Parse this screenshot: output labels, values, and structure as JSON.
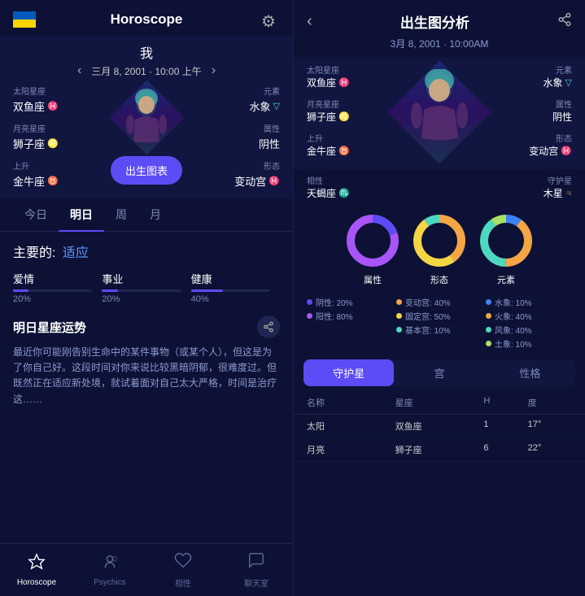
{
  "left": {
    "title": "Horoscope",
    "flag": "ukraine",
    "profile": {
      "name": "我",
      "date": "三月 8, 2001 · 10:00 上午",
      "sun_label": "太阳星座",
      "sun_value": "双鱼座",
      "sun_symbol": "♓",
      "element_label": "元素",
      "element_value": "水象",
      "element_symbol": "▽",
      "moon_label": "月亮星座",
      "moon_value": "狮子座",
      "moon_symbol": "♌",
      "attr_label": "属性",
      "attr_value": "阴性",
      "rising_label": "上升",
      "rising_value": "金牛座",
      "rising_symbol": "♉",
      "form_label": "形态",
      "form_value": "变动宫",
      "form_symbol": "♓",
      "chart_btn": "出生图表"
    },
    "tabs": [
      "今日",
      "明日",
      "周",
      "月"
    ],
    "active_tab": 1,
    "main": {
      "heading": "主要的:",
      "link": "适应",
      "stats": [
        {
          "label": "爱情",
          "pct": 20,
          "pct_label": "20%"
        },
        {
          "label": "事业",
          "pct": 20,
          "pct_label": "20%"
        },
        {
          "label": "健康",
          "pct": 40,
          "pct_label": "40%"
        }
      ],
      "section_title": "明日星座运势",
      "text": "最近你可能刚告别生命中的某件事物（或某个人），但这是为了你自己好。这段时间对你来说比较黑暗阴郁，很难度过。但既然正在适应新处境，就试着面对自己太大严格，时间是治疗这……"
    },
    "nav": [
      {
        "icon": "⭐",
        "label": "Horoscope",
        "active": true
      },
      {
        "icon": "👤",
        "label": "Psychics",
        "active": false
      },
      {
        "icon": "❤️",
        "label": "相性",
        "active": false
      },
      {
        "icon": "💬",
        "label": "聊天室",
        "active": false
      }
    ]
  },
  "right": {
    "title": "出生图分析",
    "date": "3月 8, 2001 · 10:00AM",
    "sun_label": "太阳星座",
    "sun_value": "双鱼座",
    "sun_symbol": "♓",
    "element_label": "元素",
    "element_value": "水象",
    "element_symbol": "▽",
    "moon_label": "月亮星座",
    "moon_value": "狮子座",
    "moon_symbol": "♌",
    "attr_label": "属性",
    "attr_value": "阴性",
    "rising_label": "上升",
    "rising_value": "金牛座",
    "rising_symbol": "♉",
    "form_label": "形态",
    "form_value": "变动宫",
    "form_symbol": "♓",
    "compat_label": "相性",
    "compat_value": "天蝎座",
    "compat_symbol": "♏",
    "guardian_label": "守护星",
    "guardian_value": "木星",
    "guardian_symbol": "♃",
    "donuts": [
      {
        "label": "属性",
        "segments": [
          {
            "color": "#5c4cf5",
            "pct": 20
          },
          {
            "color": "#a855f7",
            "pct": 80
          }
        ]
      },
      {
        "label": "形态",
        "segments": [
          {
            "color": "#f4a544",
            "pct": 40
          },
          {
            "color": "#f4d544",
            "pct": 50
          },
          {
            "color": "#4dd9c0",
            "pct": 10
          }
        ]
      },
      {
        "label": "元素",
        "segments": [
          {
            "color": "#3b82f6",
            "pct": 10
          },
          {
            "color": "#f4a544",
            "pct": 40
          },
          {
            "color": "#4dd9c0",
            "pct": 40
          },
          {
            "color": "#a8e063",
            "pct": 10
          }
        ]
      }
    ],
    "legend": [
      [
        {
          "color": "#5c4cf5",
          "text": "阴性: 20%"
        },
        {
          "color": "#a855f7",
          "text": "阳性: 80%"
        }
      ],
      [
        {
          "color": "#f4a544",
          "text": "变动宫: 40%"
        },
        {
          "color": "#f4d544",
          "text": "固定宫: 50%"
        },
        {
          "color": "#4dd9c0",
          "text": "基本宫: 10%"
        }
      ],
      [
        {
          "color": "#3b82f6",
          "text": "水象: 10%"
        },
        {
          "color": "#f4a544",
          "text": "火象: 40%"
        },
        {
          "color": "#4dd9c0",
          "text": "风象: 40%"
        },
        {
          "color": "#a8e063",
          "text": "土象: 10%"
        }
      ]
    ],
    "bottom_tabs": [
      "守护星",
      "宫",
      "性格"
    ],
    "active_tab": 0,
    "table_headers": [
      "名称",
      "星座",
      "H",
      "度"
    ],
    "table_rows": [
      {
        "name": "太阳",
        "sign": "双鱼座",
        "h": "1",
        "deg": "17°"
      },
      {
        "name": "月亮",
        "sign": "狮子座",
        "h": "6",
        "deg": "22°"
      }
    ]
  }
}
